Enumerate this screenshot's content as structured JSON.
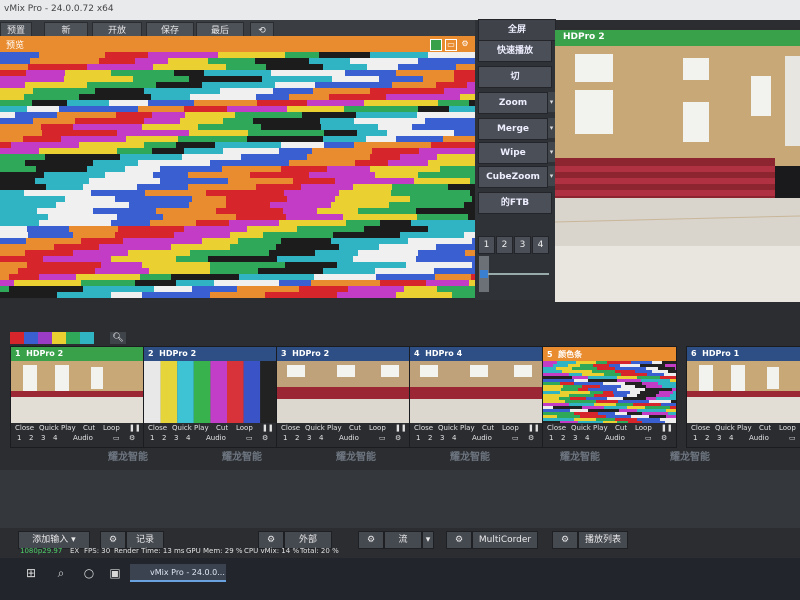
{
  "window": {
    "title": "vMix Pro - 24.0.0.72 x64"
  },
  "menu": {
    "items": [
      "预置",
      "新",
      "开放",
      "保存",
      "最后"
    ],
    "refresh_icon": "refresh-icon"
  },
  "preview": {
    "label": "预览"
  },
  "transitions": {
    "fullscreen": "全屏",
    "quickplay": "快速播放",
    "cut": "切",
    "buttons": [
      "Zoom",
      "Merge",
      "Wipe",
      "CubeZoom"
    ],
    "ftb": "的FTB",
    "numbers": [
      "1",
      "2",
      "3",
      "4"
    ]
  },
  "output": {
    "label": "HDPro 2"
  },
  "swatches": [
    "#d6262c",
    "#3a5fd0",
    "#9a3cc6",
    "#ead030",
    "#2fa85a",
    "#30b4c4"
  ],
  "inputs": [
    {
      "num": "1",
      "name": "HDPro 2",
      "color": "#3aa14b",
      "kind": "gym"
    },
    {
      "num": "2",
      "name": "HDPro 2",
      "color": "#2d4f86",
      "kind": "bars"
    },
    {
      "num": "3",
      "name": "HDPro 2",
      "color": "#2d4f86",
      "kind": "seats"
    },
    {
      "num": "4",
      "name": "HDPro 4",
      "color": "#2d4f86",
      "kind": "seats"
    },
    {
      "num": "5",
      "name": "颜色条",
      "color": "#e98c30",
      "kind": "noise"
    },
    {
      "num": "6",
      "name": "HDPro 1",
      "color": "#2d4f86",
      "kind": "gym"
    }
  ],
  "tile_controls": {
    "close": "Close",
    "quickplay": "Quick Play",
    "cut": "Cut",
    "loop": "Loop",
    "audio": "Audio",
    "nums": [
      "1",
      "2",
      "3",
      "4"
    ]
  },
  "watermark": "耀龙智能",
  "toolbar": {
    "add_input": "添加输入",
    "record": "记录",
    "external": "外部",
    "stream": "流",
    "multicorder": "MultiCorder",
    "playlist": "播放列表"
  },
  "status": {
    "format": "1080p29.97",
    "ex": "EX",
    "fps": "FPS: 30",
    "render": "Render Time: 13 ms",
    "gpu": "GPU Mem: 29 %",
    "cpu": "CPU vMix: 14 %",
    "total": "Total: 20 %"
  },
  "taskbar": {
    "app_label": "vMix Pro - 24.0.0..."
  },
  "colors": {
    "orange": "#e98c30",
    "green": "#3aa14b",
    "blue": "#2d4f86"
  }
}
